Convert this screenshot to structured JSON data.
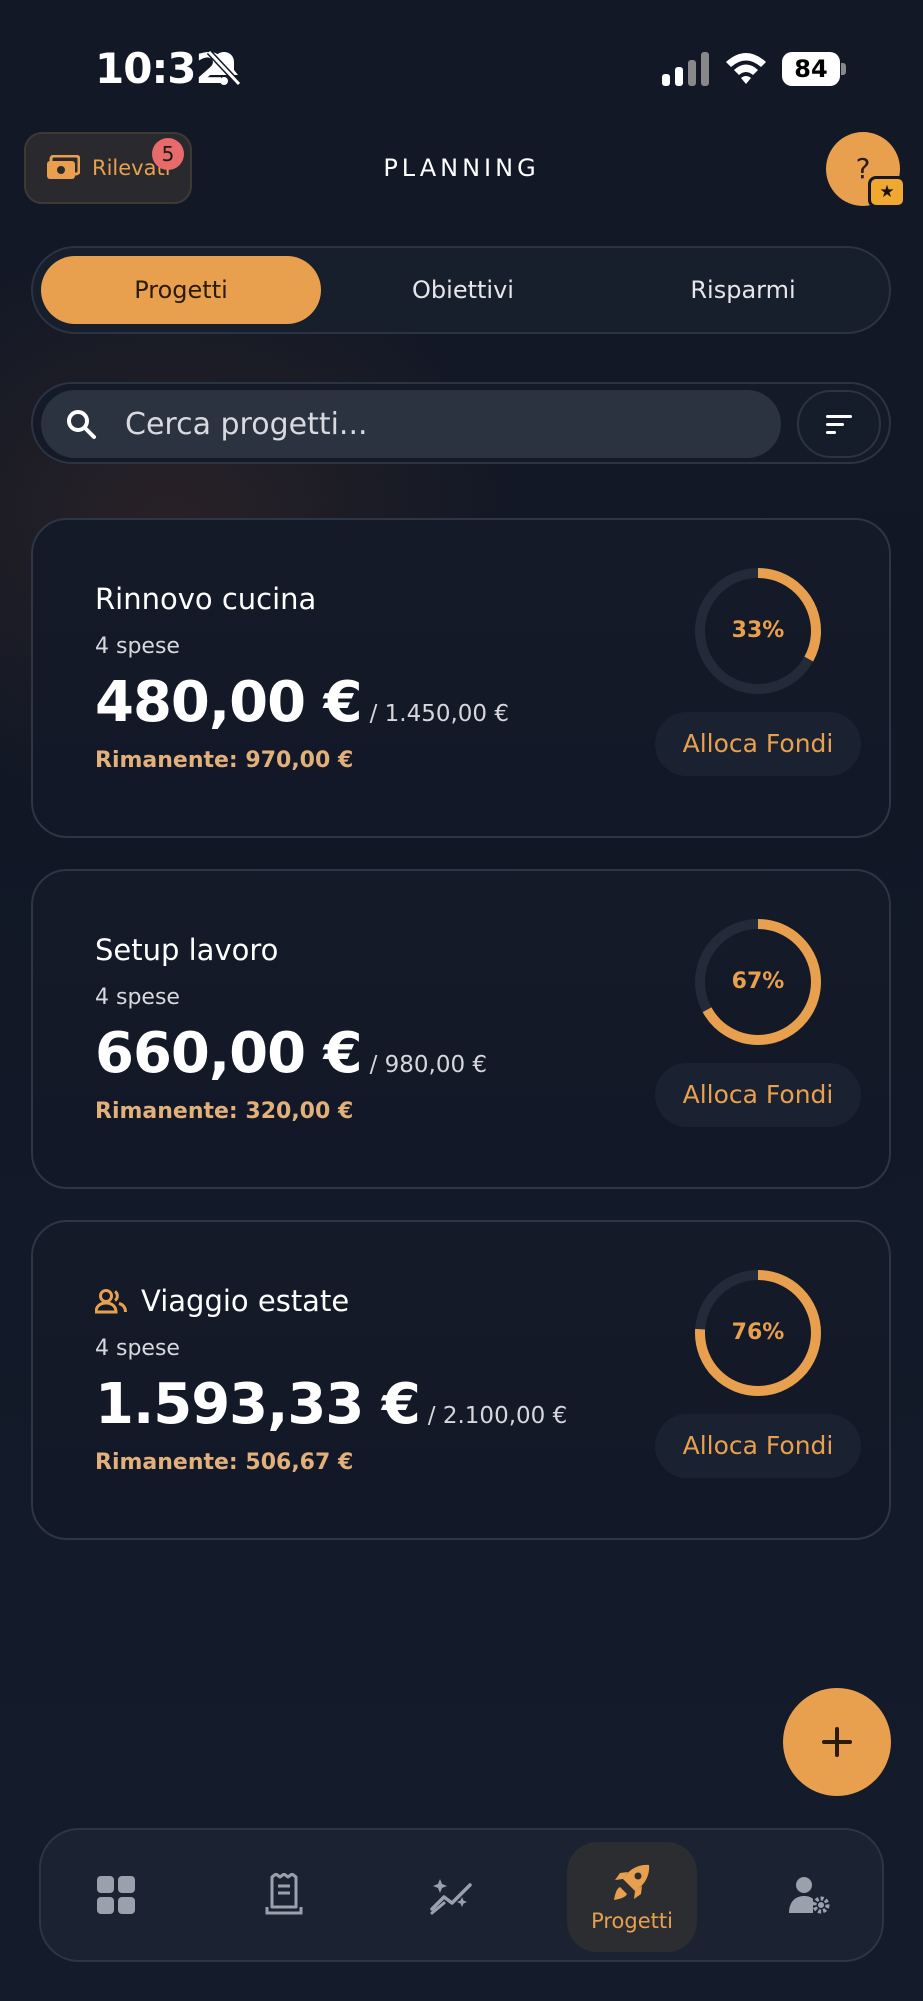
{
  "status_bar": {
    "time": "10:32",
    "battery": "84"
  },
  "header": {
    "rilevati_label": "Rilevati",
    "rilevati_badge": "5",
    "title": "PLANNING",
    "help_label": "?",
    "star_badge": "★"
  },
  "tabs": [
    {
      "label": "Progetti",
      "active": true
    },
    {
      "label": "Obiettivi",
      "active": false
    },
    {
      "label": "Risparmi",
      "active": false
    }
  ],
  "search": {
    "placeholder": "Cerca progetti..."
  },
  "projects": [
    {
      "title": "Rinnovo cucina",
      "shared": false,
      "count": "4 spese",
      "amount": "480,00 €",
      "total": "/ 1.450,00 €",
      "remaining": "Rimanente: 970,00 €",
      "percent_label": "33%",
      "progress": 0.33,
      "button": "Alloca Fondi"
    },
    {
      "title": "Setup lavoro",
      "shared": false,
      "count": "4 spese",
      "amount": "660,00 €",
      "total": "/ 980,00 €",
      "remaining": "Rimanente: 320,00 €",
      "percent_label": "67%",
      "progress": 0.67,
      "button": "Alloca Fondi"
    },
    {
      "title": "Viaggio estate",
      "shared": true,
      "count": "4 spese",
      "amount": "1.593,33 €",
      "total": "/ 2.100,00 €",
      "remaining": "Rimanente: 506,67 €",
      "percent_label": "76%",
      "progress": 0.76,
      "button": "Alloca Fondi"
    }
  ],
  "bottom_nav": [
    {
      "icon": "dashboard-icon",
      "label": ""
    },
    {
      "icon": "receipt-icon",
      "label": ""
    },
    {
      "icon": "sparkle-chart-icon",
      "label": ""
    },
    {
      "icon": "rocket-icon",
      "label": "Progetti",
      "active": true
    },
    {
      "icon": "user-settings-icon",
      "label": ""
    }
  ],
  "colors": {
    "accent": "#e8a04e",
    "background": "#121826",
    "badge": "#e86b6b"
  }
}
